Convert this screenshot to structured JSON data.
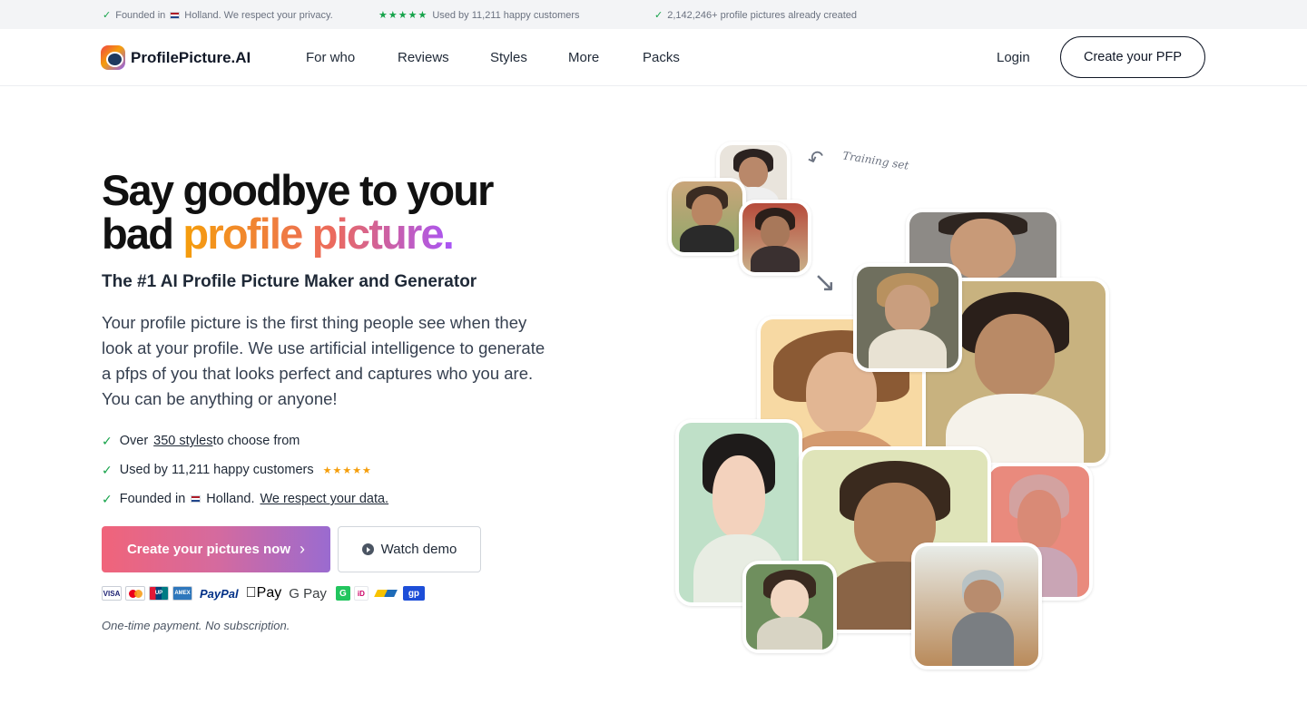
{
  "topbar": {
    "founded_prefix": "Founded in",
    "founded_suffix": "Holland. We respect your privacy.",
    "stars": "★★★★★",
    "used_by": "Used by 11,211 happy customers",
    "created": "2,142,246+ profile pictures already created"
  },
  "nav": {
    "brand": "ProfilePicture.AI",
    "links": [
      "For who",
      "Reviews",
      "Styles",
      "More",
      "Packs"
    ],
    "login": "Login",
    "cta": "Create your PFP"
  },
  "hero": {
    "headline_line1": "Say goodbye to your",
    "headline_line2_plain": "bad ",
    "headline_line2_accent": "profile picture.",
    "subhead": "The #1 AI Profile Picture Maker and Generator",
    "description": "Your profile picture is the first thing people see when they look at your profile. We use artificial intelligence to generate a pfps of you that looks perfect and captures who you are. You can be anything or anyone!",
    "bullets": {
      "b1_prefix": "Over",
      "b1_link": "350 styles ",
      "b1_suffix": "to choose from",
      "b2_text": "Used by 11,211 happy customers",
      "b2_stars": "★★★★★",
      "b3_prefix": "Founded in",
      "b3_country": "Holland.",
      "b3_link": "We respect your data."
    },
    "primary_cta": "Create your pictures now",
    "primary_chevron": "›",
    "secondary_cta": "Watch demo",
    "payments": {
      "visa": "VISA",
      "unionpay": "UP",
      "amex": "AMEX",
      "paypal": "PayPal",
      "applepay": "Pay",
      "googlepay": "G Pay",
      "giropay": "G",
      "ideal": "iD",
      "gp": "gp"
    },
    "payment_note": "One-time payment. No subscription."
  },
  "collage": {
    "training_label": "Training set",
    "curved_arrow": "↶",
    "down_arrow": "↘"
  },
  "colors": {
    "accent_green": "#16a34a",
    "star_orange": "#f59e0b",
    "gradient_start": "#f0647a",
    "gradient_end": "#9a6bd0"
  }
}
